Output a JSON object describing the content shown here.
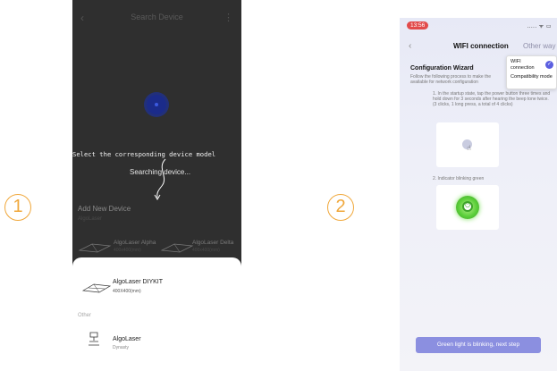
{
  "steps": {
    "one": "1",
    "two": "2"
  },
  "screen1": {
    "header_title": "Search Device",
    "back_icon": "chevron-left-icon",
    "more_icon": "more-vertical-icon",
    "tip": "Select the corresponding device model",
    "searching": "Searching device...",
    "add_title": "Add New Device",
    "add_subtitle": "AlgoLaser",
    "cards": [
      {
        "name": "AlgoLaser Alpha",
        "size": "400x400(mm)"
      },
      {
        "name": "AlgoLaser Delta",
        "size": "400x400(mm)"
      }
    ],
    "sheet": {
      "device1_name": "AlgoLaser DIYKIT",
      "device1_size": "400X400(mm)",
      "other_label": "Other",
      "device2_name": "AlgoLaser",
      "device2_sub": "Dynasty"
    }
  },
  "screen2": {
    "time": "13:56",
    "status": "..... ᯤ ▭",
    "back_icon": "chevron-left-icon",
    "title": "WIFI connection",
    "other_way": "Other way",
    "popup": {
      "option1": "WIFI connection",
      "option2": "Compatibility mode",
      "check_icon": "check-circle-icon"
    },
    "wizard_title": "Configuration Wizard",
    "wizard_desc": "Follow the following process to make the available for network configuration",
    "step1": "1. In the startup state, tap the power button three times and hold down for 3 seconds after hearing the beep tone twice. (3 clicks, 1 long press, a total of 4 clicks)",
    "step2": "2. Indicator blinking green",
    "next_button": "Green light is blinking, next step",
    "colors": {
      "accent": "#8b8fe0",
      "check": "#5b5fe0",
      "indicator": "#5bcf3a",
      "step_badge": "#f0a73a"
    }
  }
}
